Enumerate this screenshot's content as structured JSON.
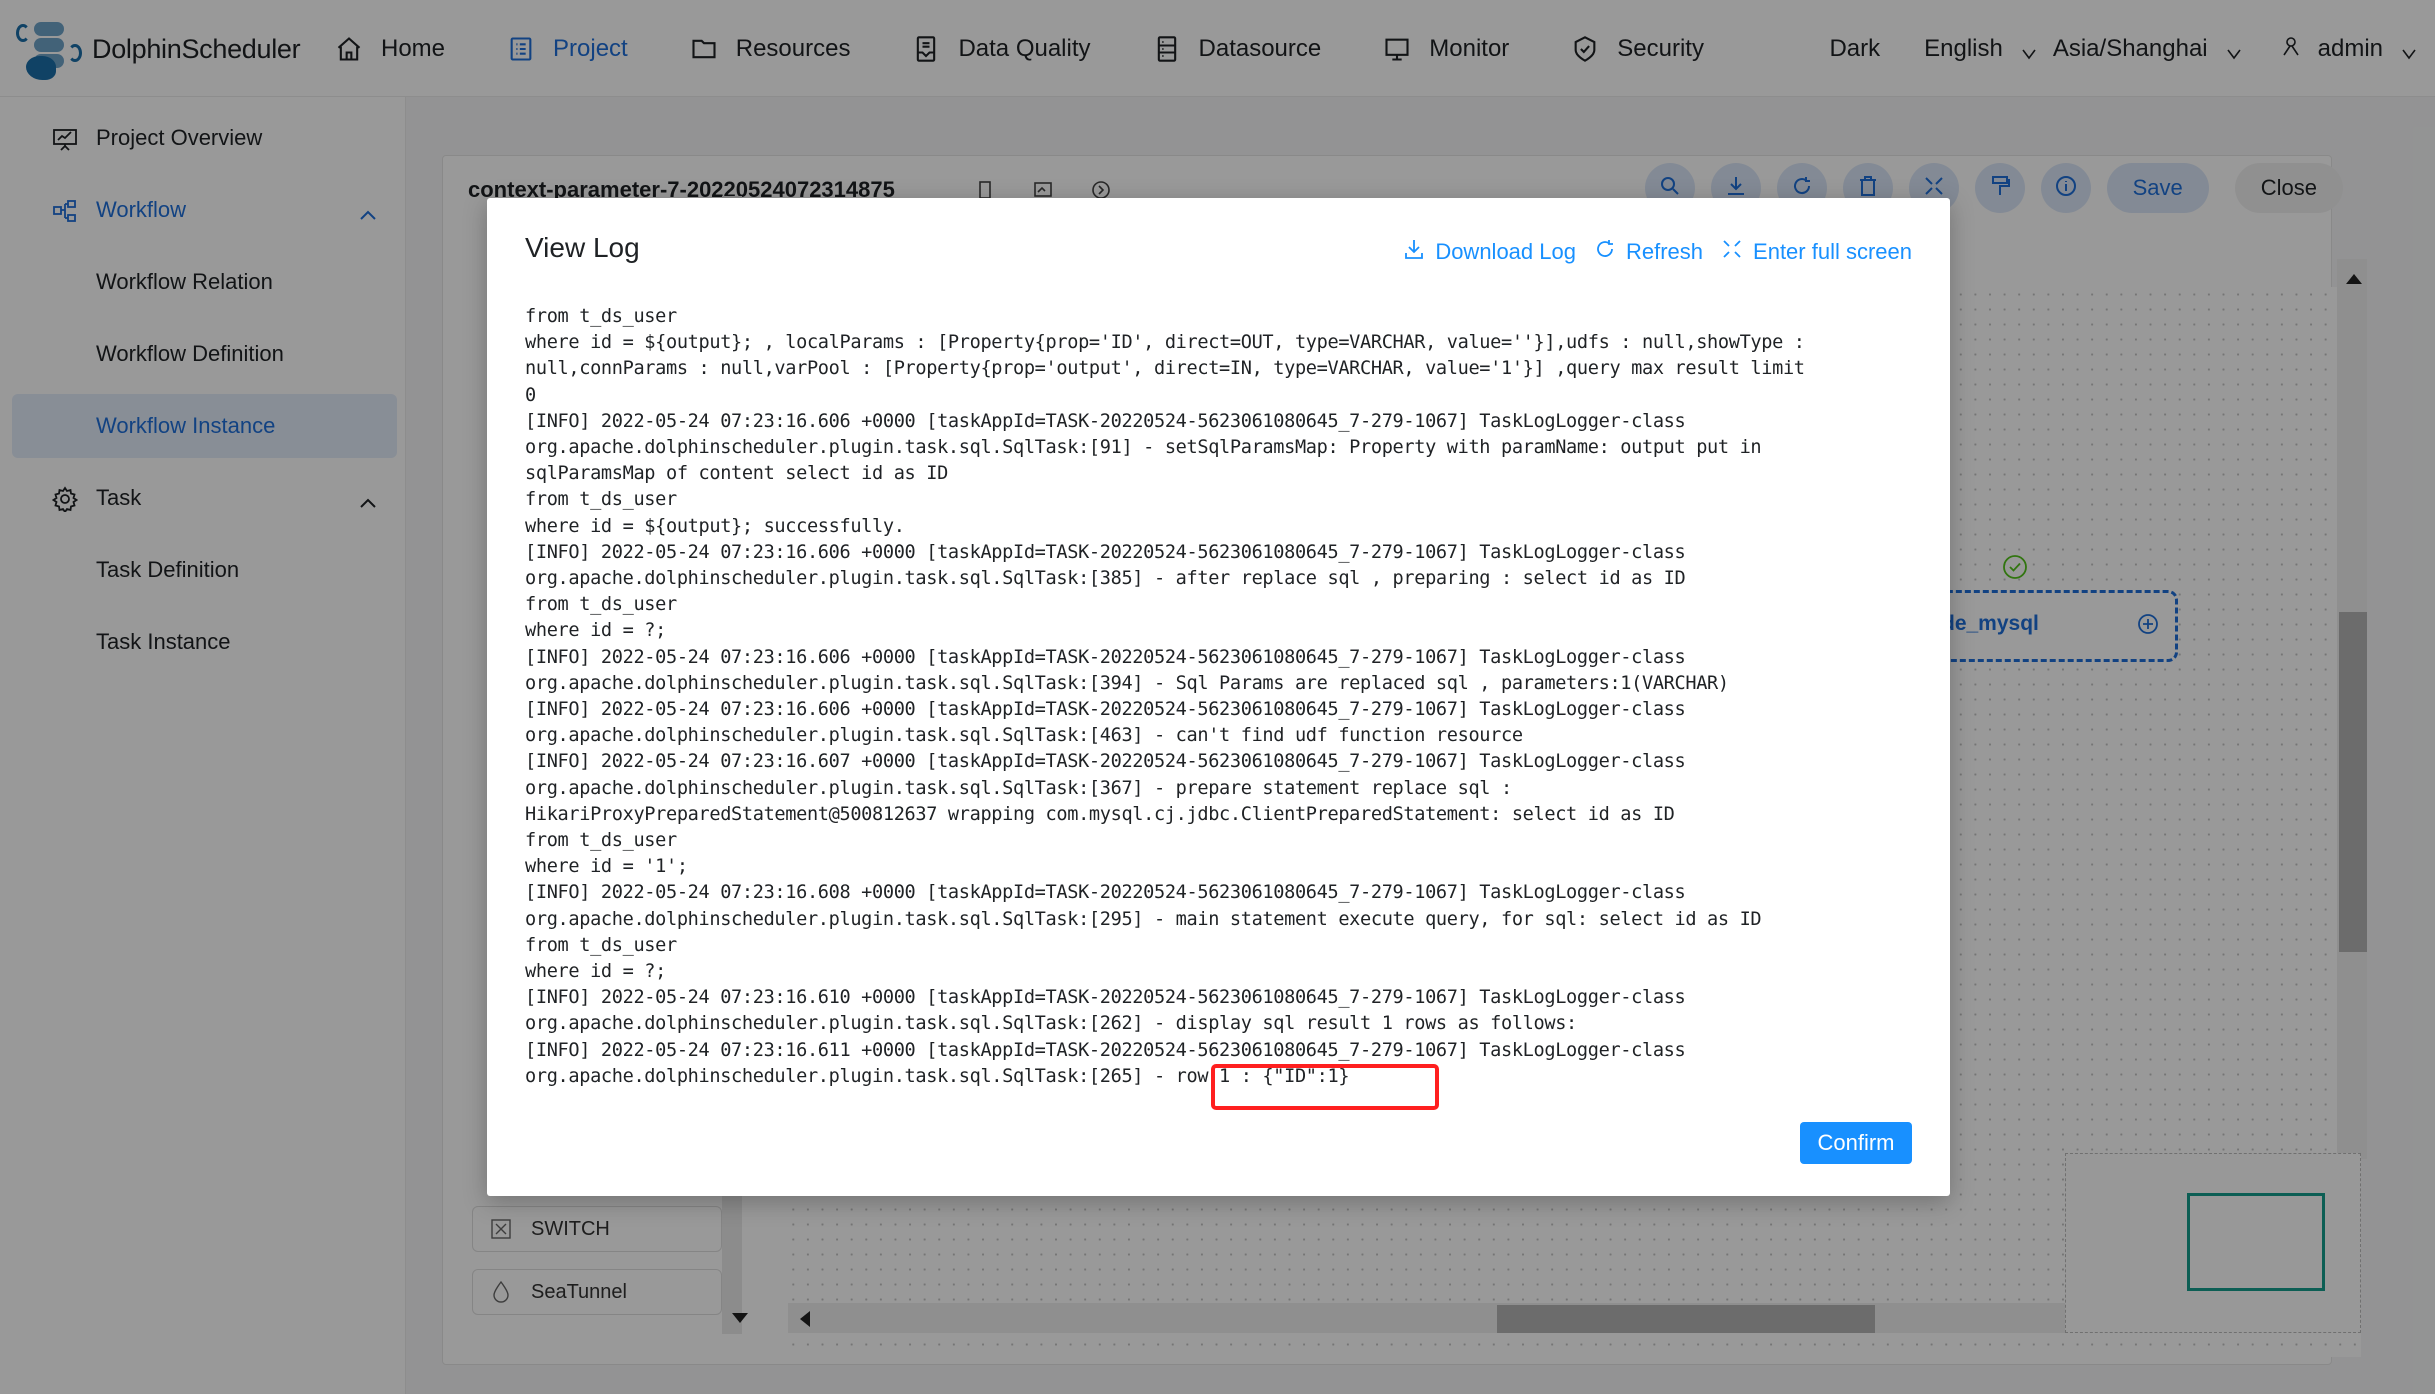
{
  "app": {
    "name": "DolphinScheduler"
  },
  "topnav": {
    "items": [
      {
        "label": "Home",
        "icon": "home-icon"
      },
      {
        "label": "Project",
        "icon": "project-icon",
        "active": true
      },
      {
        "label": "Resources",
        "icon": "folder-icon"
      },
      {
        "label": "Data Quality",
        "icon": "data-quality-icon"
      },
      {
        "label": "Datasource",
        "icon": "datasource-icon"
      },
      {
        "label": "Monitor",
        "icon": "monitor-icon"
      },
      {
        "label": "Security",
        "icon": "shield-icon"
      }
    ],
    "theme": "Dark",
    "language": "English",
    "timezone": "Asia/Shanghai",
    "user": "admin"
  },
  "sidebar": {
    "items": [
      {
        "label": "Project Overview",
        "icon": "presentation-chart-icon"
      },
      {
        "label": "Workflow",
        "icon": "workflow-icon",
        "expanded": true
      },
      {
        "label": "Workflow Relation"
      },
      {
        "label": "Workflow Definition"
      },
      {
        "label": "Workflow Instance",
        "selected": true
      },
      {
        "label": "Task",
        "icon": "gear-icon",
        "expanded": true
      },
      {
        "label": "Task Definition"
      },
      {
        "label": "Task Instance"
      }
    ]
  },
  "workflow": {
    "title": "context-parameter-7-20220524072314875",
    "toolbar": {
      "save_label": "Save",
      "close_label": "Close"
    },
    "palette": [
      {
        "label": "SWITCH",
        "icon": "switch-icon"
      },
      {
        "label": "SeaTunnel",
        "icon": "seatunnel-icon"
      }
    ],
    "node": {
      "label": "de_mysql"
    }
  },
  "modal": {
    "title": "View Log",
    "actions": {
      "download": "Download Log",
      "refresh": "Refresh",
      "fullscreen": "Enter full screen"
    },
    "log_lines": [
      "from t_ds_user",
      "where id = ${output}; , localParams : [Property{prop='ID', direct=OUT, type=VARCHAR, value=''}],udfs : null,showType :",
      "null,connParams : null,varPool : [Property{prop='output', direct=IN, type=VARCHAR, value='1'}] ,query max result limit",
      "0",
      "[INFO] 2022-05-24 07:23:16.606 +0000 [taskAppId=TASK-20220524-5623061080645_7-279-1067] TaskLogLogger-class",
      "org.apache.dolphinscheduler.plugin.task.sql.SqlTask:[91] - setSqlParamsMap: Property with paramName: output put in",
      "sqlParamsMap of content select id as ID",
      "from t_ds_user",
      "where id = ${output}; successfully.",
      "[INFO] 2022-05-24 07:23:16.606 +0000 [taskAppId=TASK-20220524-5623061080645_7-279-1067] TaskLogLogger-class",
      "org.apache.dolphinscheduler.plugin.task.sql.SqlTask:[385] - after replace sql , preparing : select id as ID",
      "from t_ds_user",
      "where id = ?;",
      "[INFO] 2022-05-24 07:23:16.606 +0000 [taskAppId=TASK-20220524-5623061080645_7-279-1067] TaskLogLogger-class",
      "org.apache.dolphinscheduler.plugin.task.sql.SqlTask:[394] - Sql Params are replaced sql , parameters:1(VARCHAR)",
      "[INFO] 2022-05-24 07:23:16.606 +0000 [taskAppId=TASK-20220524-5623061080645_7-279-1067] TaskLogLogger-class",
      "org.apache.dolphinscheduler.plugin.task.sql.SqlTask:[463] - can't find udf function resource",
      "[INFO] 2022-05-24 07:23:16.607 +0000 [taskAppId=TASK-20220524-5623061080645_7-279-1067] TaskLogLogger-class",
      "org.apache.dolphinscheduler.plugin.task.sql.SqlTask:[367] - prepare statement replace sql :",
      "HikariProxyPreparedStatement@500812637 wrapping com.mysql.cj.jdbc.ClientPreparedStatement: select id as ID",
      "from t_ds_user",
      "where id = '1';",
      "[INFO] 2022-05-24 07:23:16.608 +0000 [taskAppId=TASK-20220524-5623061080645_7-279-1067] TaskLogLogger-class",
      "org.apache.dolphinscheduler.plugin.task.sql.SqlTask:[295] - main statement execute query, for sql: select id as ID",
      "from t_ds_user",
      "where id = ?;",
      "[INFO] 2022-05-24 07:23:16.610 +0000 [taskAppId=TASK-20220524-5623061080645_7-279-1067] TaskLogLogger-class",
      "org.apache.dolphinscheduler.plugin.task.sql.SqlTask:[262] - display sql result 1 rows as follows:",
      "[INFO] 2022-05-24 07:23:16.611 +0000 [taskAppId=TASK-20220524-5623061080645_7-279-1067] TaskLogLogger-class",
      "org.apache.dolphinscheduler.plugin.task.sql.SqlTask:[265] - row 1 : {\"ID\":1}"
    ],
    "highlighted_text": "row 1 : {\"ID\":1}",
    "confirm_label": "Confirm"
  },
  "colors": {
    "accent": "#1890ff",
    "nav_active": "#1e6fd9",
    "highlight_border": "#ff1f1f",
    "minimap_view": "#159d8c",
    "success": "#52c41a"
  }
}
